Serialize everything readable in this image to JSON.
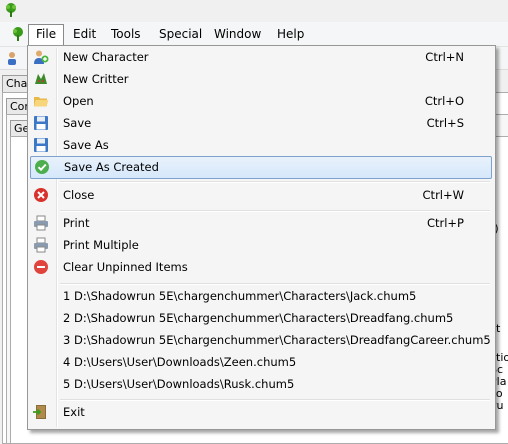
{
  "menubar": {
    "items": [
      {
        "label": "File"
      },
      {
        "label": "Edit"
      },
      {
        "label": "Tools"
      },
      {
        "label": "Special"
      },
      {
        "label": "Window"
      },
      {
        "label": "Help"
      }
    ]
  },
  "background": {
    "tab_1": "Cha",
    "tab_2": "Com",
    "tab_3": "Gen",
    "right_fragments": [
      "t)",
      "ct",
      "ctio",
      "Sc",
      "Pla",
      "Lo",
      "Pu"
    ]
  },
  "file_menu": {
    "items": [
      {
        "label": "New Character",
        "shortcut": "Ctrl+N",
        "icon": "new-character-icon"
      },
      {
        "label": "New Critter",
        "shortcut": "",
        "icon": "new-critter-icon"
      },
      {
        "label": "Open",
        "shortcut": "Ctrl+O",
        "icon": "open-folder-icon"
      },
      {
        "label": "Save",
        "shortcut": "Ctrl+S",
        "icon": "save-icon"
      },
      {
        "label": "Save As",
        "shortcut": "",
        "icon": "save-as-icon"
      },
      {
        "label": "Save As Created",
        "shortcut": "",
        "icon": "save-as-created-icon",
        "highlighted": true
      },
      {
        "label": "Close",
        "shortcut": "Ctrl+W",
        "icon": "close-icon"
      },
      {
        "label": "Print",
        "shortcut": "Ctrl+P",
        "icon": "print-icon"
      },
      {
        "label": "Print Multiple",
        "shortcut": "",
        "icon": "print-multiple-icon"
      },
      {
        "label": "Clear Unpinned Items",
        "shortcut": "",
        "icon": "clear-icon"
      },
      {
        "label": "1 D:\\Shadowrun 5E\\chargenchummer\\Characters\\Jack.chum5"
      },
      {
        "label": "2 D:\\Shadowrun 5E\\chargenchummer\\Characters\\Dreadfang.chum5"
      },
      {
        "label": "3 D:\\Shadowrun 5E\\chargenchummer\\Characters\\DreadfangCareer.chum5"
      },
      {
        "label": "4 D:\\Users\\User\\Downloads\\Zeen.chum5"
      },
      {
        "label": "5 D:\\Users\\User\\Downloads\\Rusk.chum5"
      },
      {
        "label": "Exit",
        "shortcut": "",
        "icon": "exit-icon"
      }
    ]
  },
  "colors": {
    "highlight_border": "#7da2ce",
    "menu_background": "#f5f5f5",
    "app_icon_green": "#3a9a1a"
  }
}
